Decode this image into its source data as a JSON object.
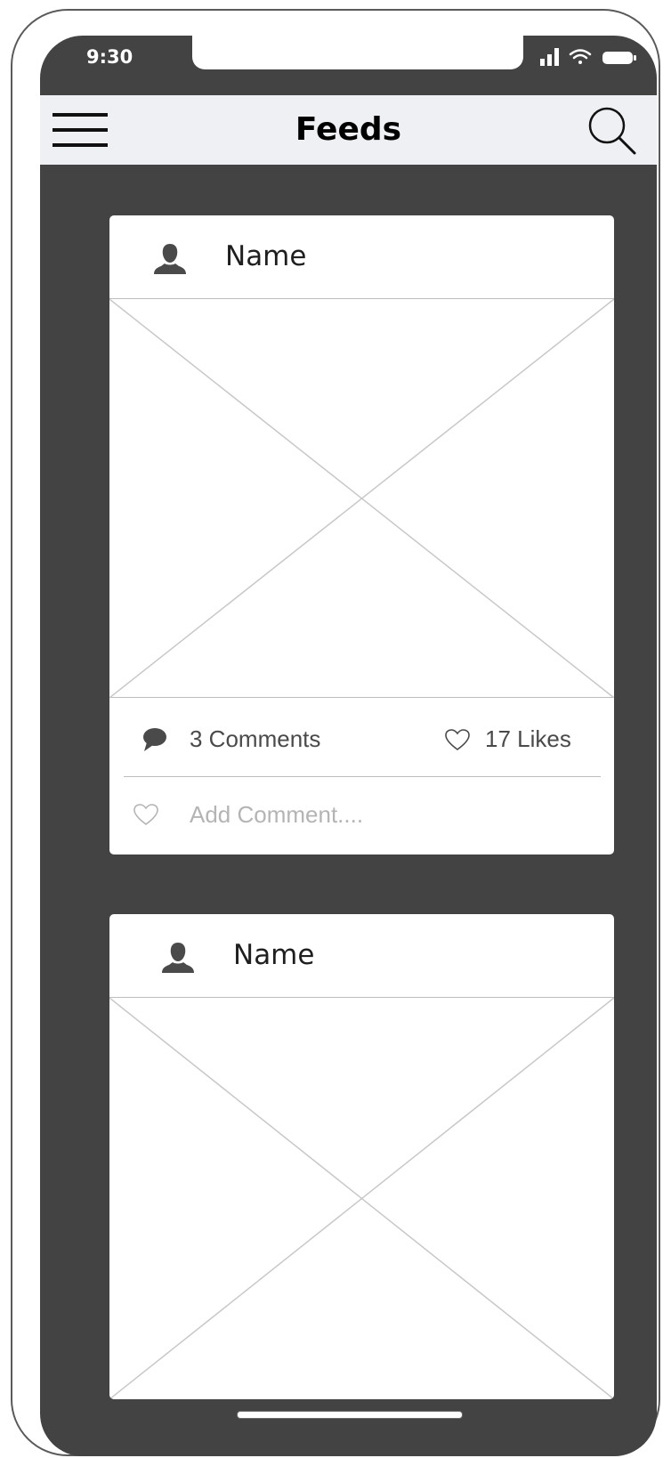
{
  "status_bar": {
    "time": "9:30",
    "icons": [
      "signal-icon",
      "wifi-icon",
      "battery-icon"
    ]
  },
  "app_bar": {
    "title": "Feeds",
    "left_icon": "menu-icon",
    "right_icon": "search-icon"
  },
  "posts": [
    {
      "author_name": "Name",
      "avatar_icon": "user-icon",
      "image": "image-placeholder",
      "comments_label": "3 Comments",
      "likes_label": "17 Likes",
      "add_comment_placeholder": "Add Comment...."
    },
    {
      "author_name": "Name",
      "avatar_icon": "user-icon",
      "image": "image-placeholder"
    }
  ],
  "colors": {
    "screen_background": "#434343",
    "app_bar_background": "#eff0f4",
    "card_background": "#ffffff",
    "icon_gray": "#4a4a4a",
    "divider": "#bdbdbd"
  }
}
